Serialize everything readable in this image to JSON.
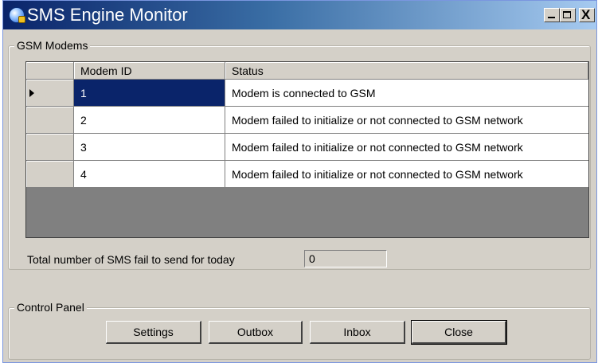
{
  "window": {
    "title": "SMS Engine Monitor",
    "controls": {
      "minimize": "minimize",
      "maximize": "maximize",
      "close": "X"
    }
  },
  "gsm_group": {
    "title": "GSM Modems",
    "grid": {
      "columns": [
        "Modem ID",
        "Status"
      ],
      "selected_row": 0,
      "rows": [
        {
          "modem_id": "1",
          "status": "Modem is connected to GSM"
        },
        {
          "modem_id": "2",
          "status": "Modem failed to initialize or not connected to GSM network"
        },
        {
          "modem_id": "3",
          "status": "Modem failed to initialize or not connected to GSM network"
        },
        {
          "modem_id": "4",
          "status": "Modem failed to initialize or not connected to GSM network"
        }
      ]
    },
    "fail_label": "Total number of SMS fail to send for today",
    "fail_count": "0"
  },
  "control_panel": {
    "title": "Control Panel",
    "buttons": [
      "Settings",
      "Outbox",
      "Inbox",
      "Close"
    ]
  },
  "colors": {
    "titlebar_start": "#0a246a",
    "titlebar_end": "#a6caf0",
    "selection": "#0a246a",
    "grid_empty_area": "#808080",
    "face": "#d4d0c8"
  },
  "icons": {
    "app": "sms-engine-icon",
    "row_pointer": "row-pointer-arrow-icon"
  }
}
